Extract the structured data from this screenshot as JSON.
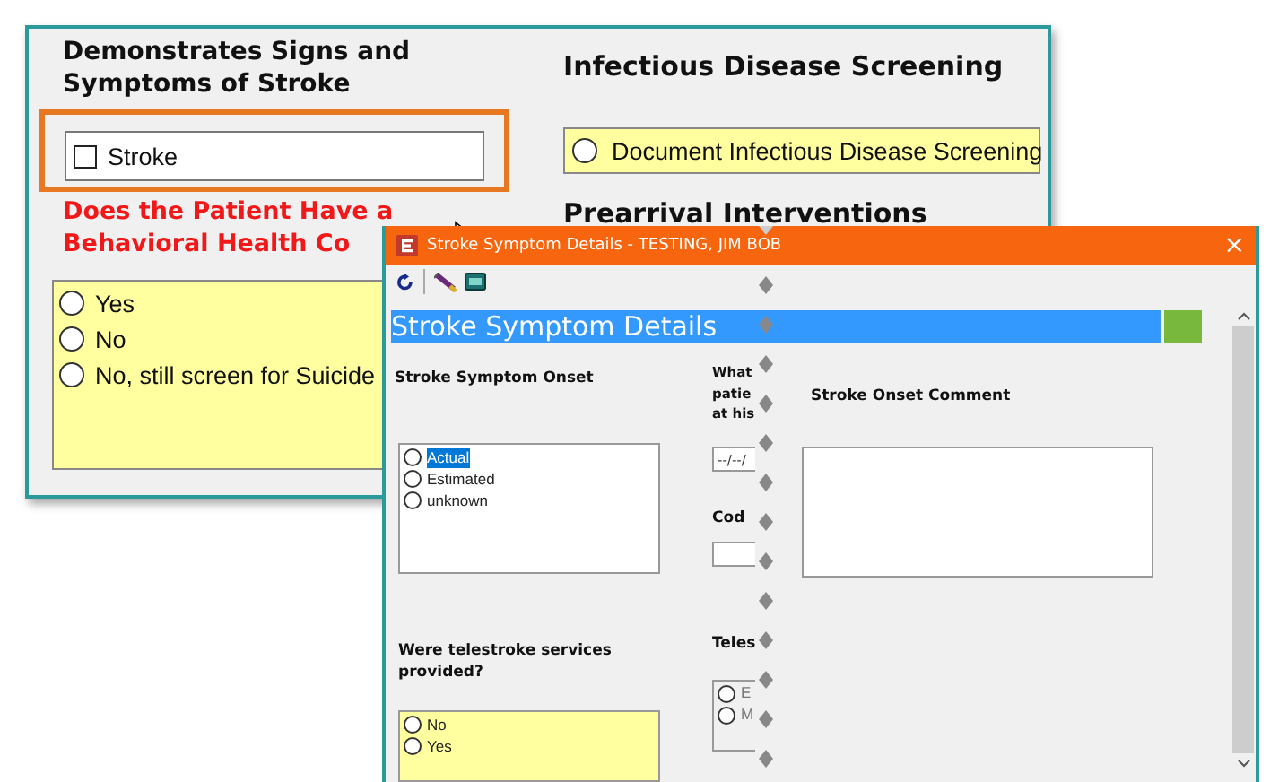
{
  "background_form": {
    "stroke_section": {
      "heading": "Demonstrates Signs and Symptoms of Stroke",
      "checkbox": {
        "label": "Stroke",
        "checked": false
      }
    },
    "behavioral_section": {
      "heading_lines": [
        "Does the Patient Have a",
        "Behavioral Health Co"
      ],
      "options": [
        {
          "label": "Yes",
          "selected": false
        },
        {
          "label": "No",
          "selected": false
        },
        {
          "label": "No, still screen for Suicide",
          "selected": false
        }
      ]
    },
    "infectious_section": {
      "heading": "Infectious Disease Screening",
      "option": {
        "label": "Document Infectious Disease Screening",
        "selected": false
      }
    },
    "prearrival_heading": "Prearrival Interventions"
  },
  "dialog": {
    "title": "Stroke Symptom Details - TESTING, JIM BOB",
    "close": "×",
    "header": "Stroke Symptom Details",
    "onset": {
      "heading": "Stroke Symptom Onset",
      "options": [
        {
          "label": "Actual",
          "selected": false,
          "focused": true
        },
        {
          "label": "Estimated",
          "selected": false,
          "focused": false
        },
        {
          "label": "unknown",
          "selected": false,
          "focused": false
        }
      ]
    },
    "telestroke": {
      "heading": "Were telestroke services provided?",
      "options": [
        {
          "label": "No",
          "selected": false
        },
        {
          "label": "Yes",
          "selected": false
        }
      ]
    },
    "middle": {
      "question_lines": [
        "What",
        "patie",
        "at his"
      ],
      "date_value": "--/--/",
      "code_label": "Cod",
      "teles_label": "Teles",
      "options": [
        {
          "label": "E",
          "selected": false
        },
        {
          "label": "M",
          "selected": false
        }
      ]
    },
    "comment": {
      "heading": "Stroke Onset Comment"
    }
  }
}
